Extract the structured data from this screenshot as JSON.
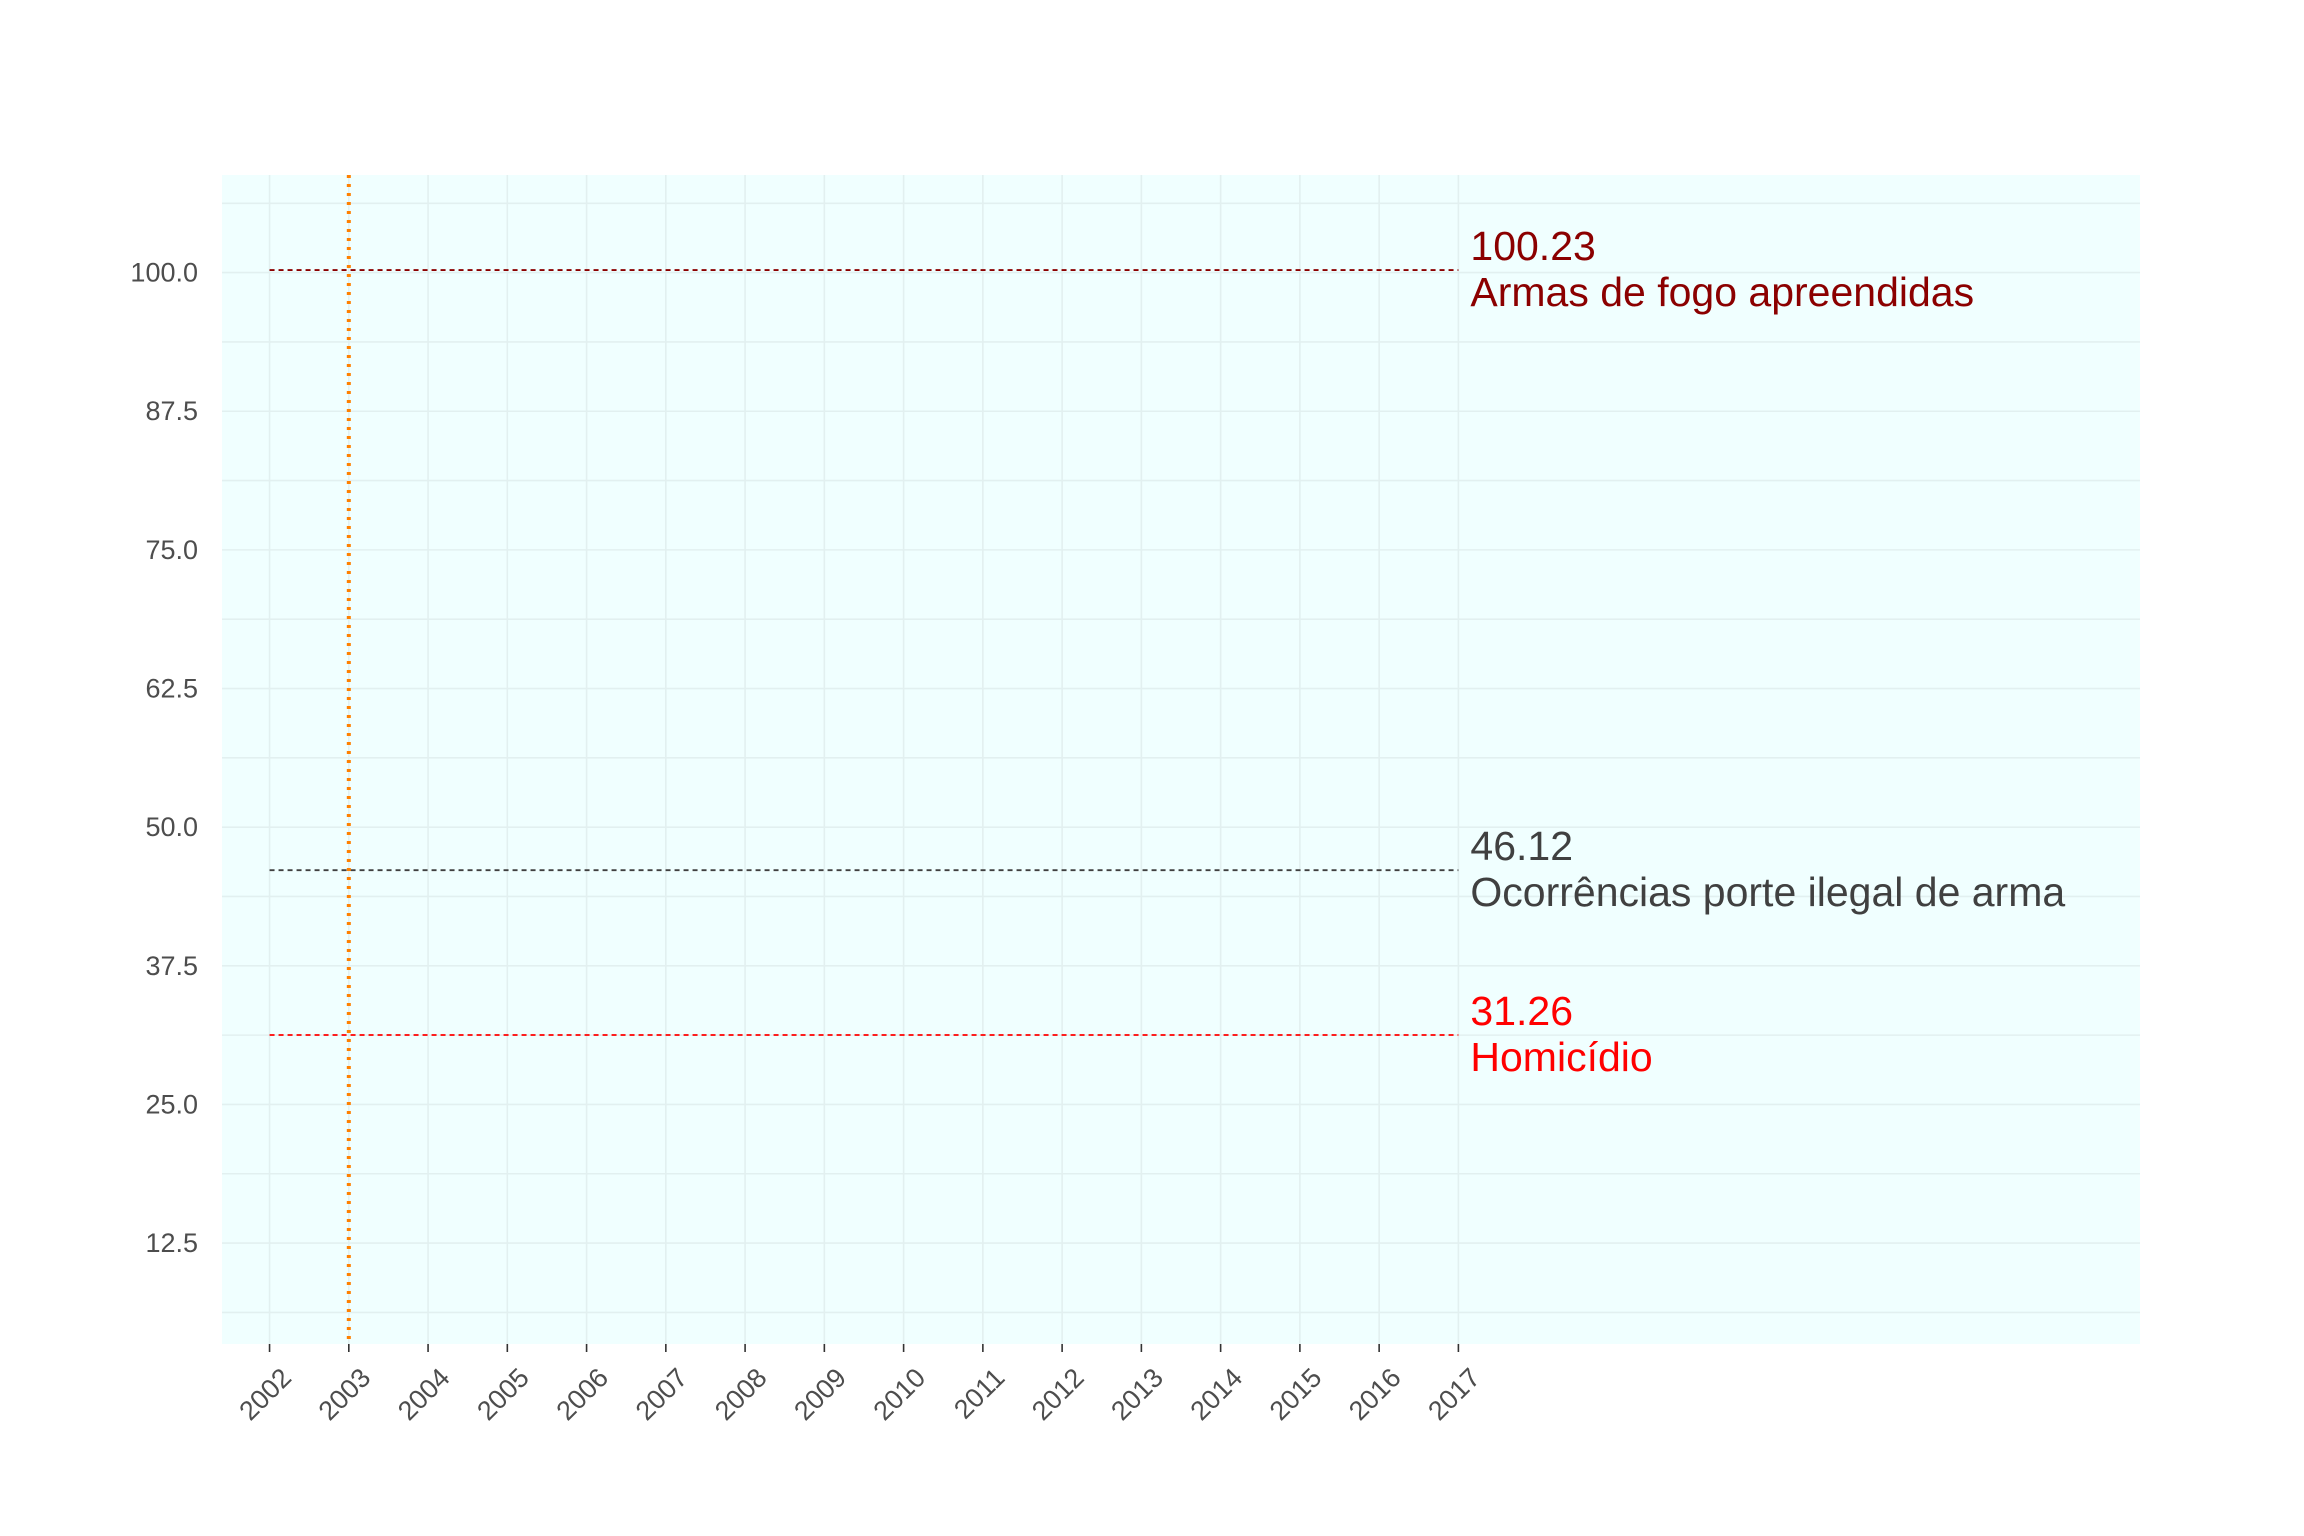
{
  "chart_data": {
    "type": "line",
    "title": "",
    "xlabel": "",
    "ylabel": "",
    "x": [
      2002,
      2003,
      2004,
      2005,
      2006,
      2007,
      2008,
      2009,
      2010,
      2011,
      2012,
      2013,
      2014,
      2015,
      2016,
      2017
    ],
    "x_tick_labels": [
      "2002",
      "2003",
      "2004",
      "2005",
      "2006",
      "2007",
      "2008",
      "2009",
      "2010",
      "2011",
      "2012",
      "2013",
      "2014",
      "2015",
      "2016",
      "2017"
    ],
    "y_tick_labels": [
      "12.5",
      "25.0",
      "37.5",
      "50.0",
      "62.5",
      "75.0",
      "87.5",
      "100.0"
    ],
    "y_ticks": [
      12.5,
      25.0,
      37.5,
      50.0,
      62.5,
      75.0,
      87.5,
      100.0
    ],
    "ylim": [
      3.4,
      108.8
    ],
    "xlim": [
      2001.4,
      2025.6
    ],
    "grid": true,
    "background_color": "#f0ffff",
    "grid_color": "#e2f0f0",
    "vline": {
      "x": 2003,
      "color": "#ff8000",
      "style": "dotted"
    },
    "series": [
      {
        "name": "Armas de fogo apreendidas",
        "color": "#8b0000",
        "style": "dashed",
        "end_value_label": "100.23",
        "values": [
          100.23,
          100.23,
          100.23,
          100.23,
          100.23,
          100.23,
          100.23,
          100.23,
          100.23,
          100.23,
          100.23,
          100.23,
          100.23,
          100.23,
          100.23,
          100.23
        ]
      },
      {
        "name": "Ocorrências porte ilegal de arma",
        "color": "#404040",
        "style": "dashed",
        "end_value_label": "46.12",
        "values": [
          46.12,
          46.12,
          46.12,
          46.12,
          46.12,
          46.12,
          46.12,
          46.12,
          46.12,
          46.12,
          46.12,
          46.12,
          46.12,
          46.12,
          46.12,
          46.12
        ]
      },
      {
        "name": "Homicídio",
        "color": "#ff0000",
        "style": "dashed",
        "end_value_label": "31.26",
        "values": [
          31.26,
          31.26,
          31.26,
          31.26,
          31.26,
          31.26,
          31.26,
          31.26,
          31.26,
          31.26,
          31.26,
          31.26,
          31.26,
          31.26,
          31.26,
          31.26
        ]
      }
    ]
  }
}
